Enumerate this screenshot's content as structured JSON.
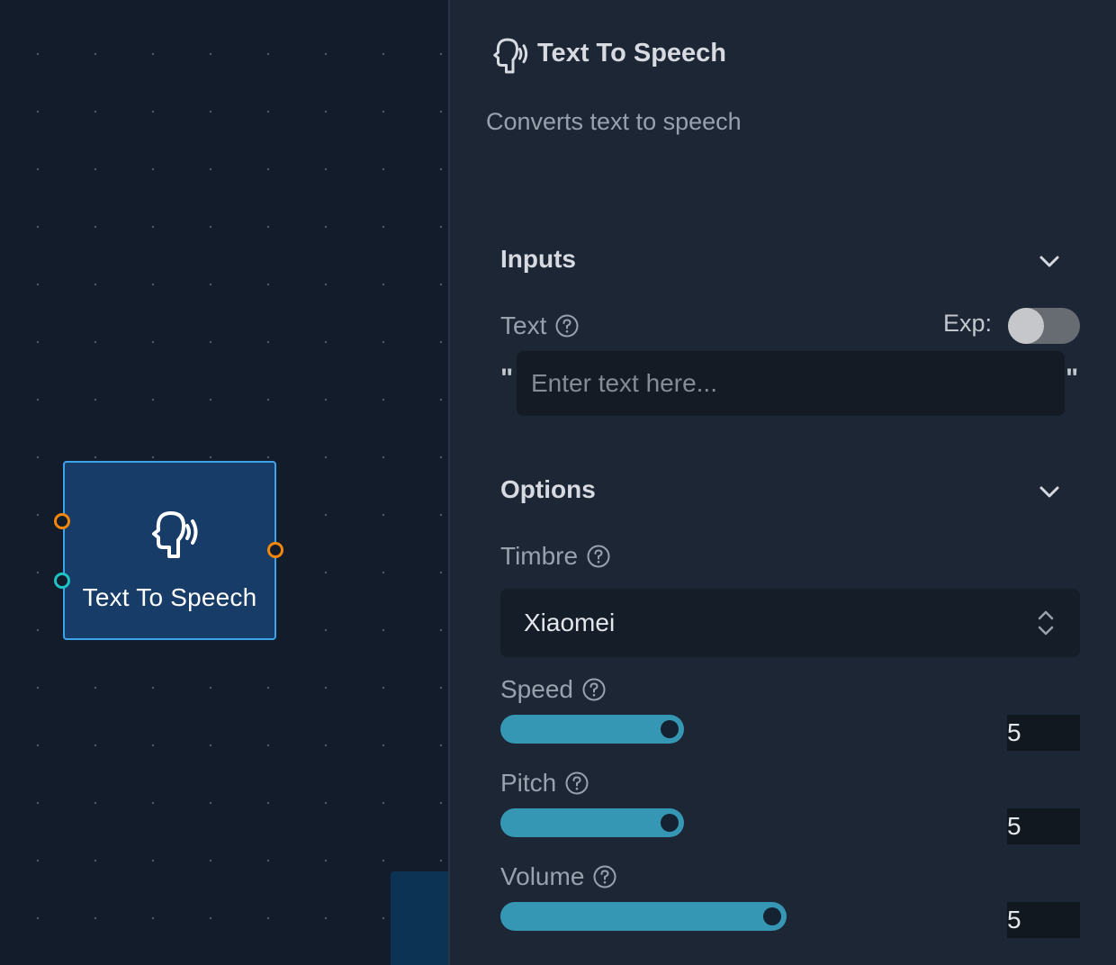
{
  "canvas": {
    "node": {
      "label": "Text To Speech",
      "icon": "speaking-head-icon"
    }
  },
  "panel": {
    "title": "Text To Speech",
    "icon": "speaking-head-icon",
    "description": "Converts text to speech",
    "inputs": {
      "section_title": "Inputs",
      "text": {
        "label": "Text",
        "exp_label": "Exp:",
        "exp_enabled": false,
        "open_quote": "\"",
        "close_quote": "\"",
        "placeholder": "Enter text here...",
        "value": ""
      }
    },
    "options": {
      "section_title": "Options",
      "timbre": {
        "label": "Timbre",
        "value": "Xiaomei"
      },
      "speed": {
        "label": "Speed",
        "value": "5"
      },
      "pitch": {
        "label": "Pitch",
        "value": "5"
      },
      "volume": {
        "label": "Volume",
        "value": "5"
      }
    }
  },
  "colors": {
    "canvas_bg": "#131c2a",
    "panel_bg": "#1c2635",
    "node_fill": "#173c67",
    "node_border": "#3ba4ea",
    "port_orange": "#f5870a",
    "port_teal": "#1ec4c4",
    "slider_fill": "#3597b3"
  }
}
